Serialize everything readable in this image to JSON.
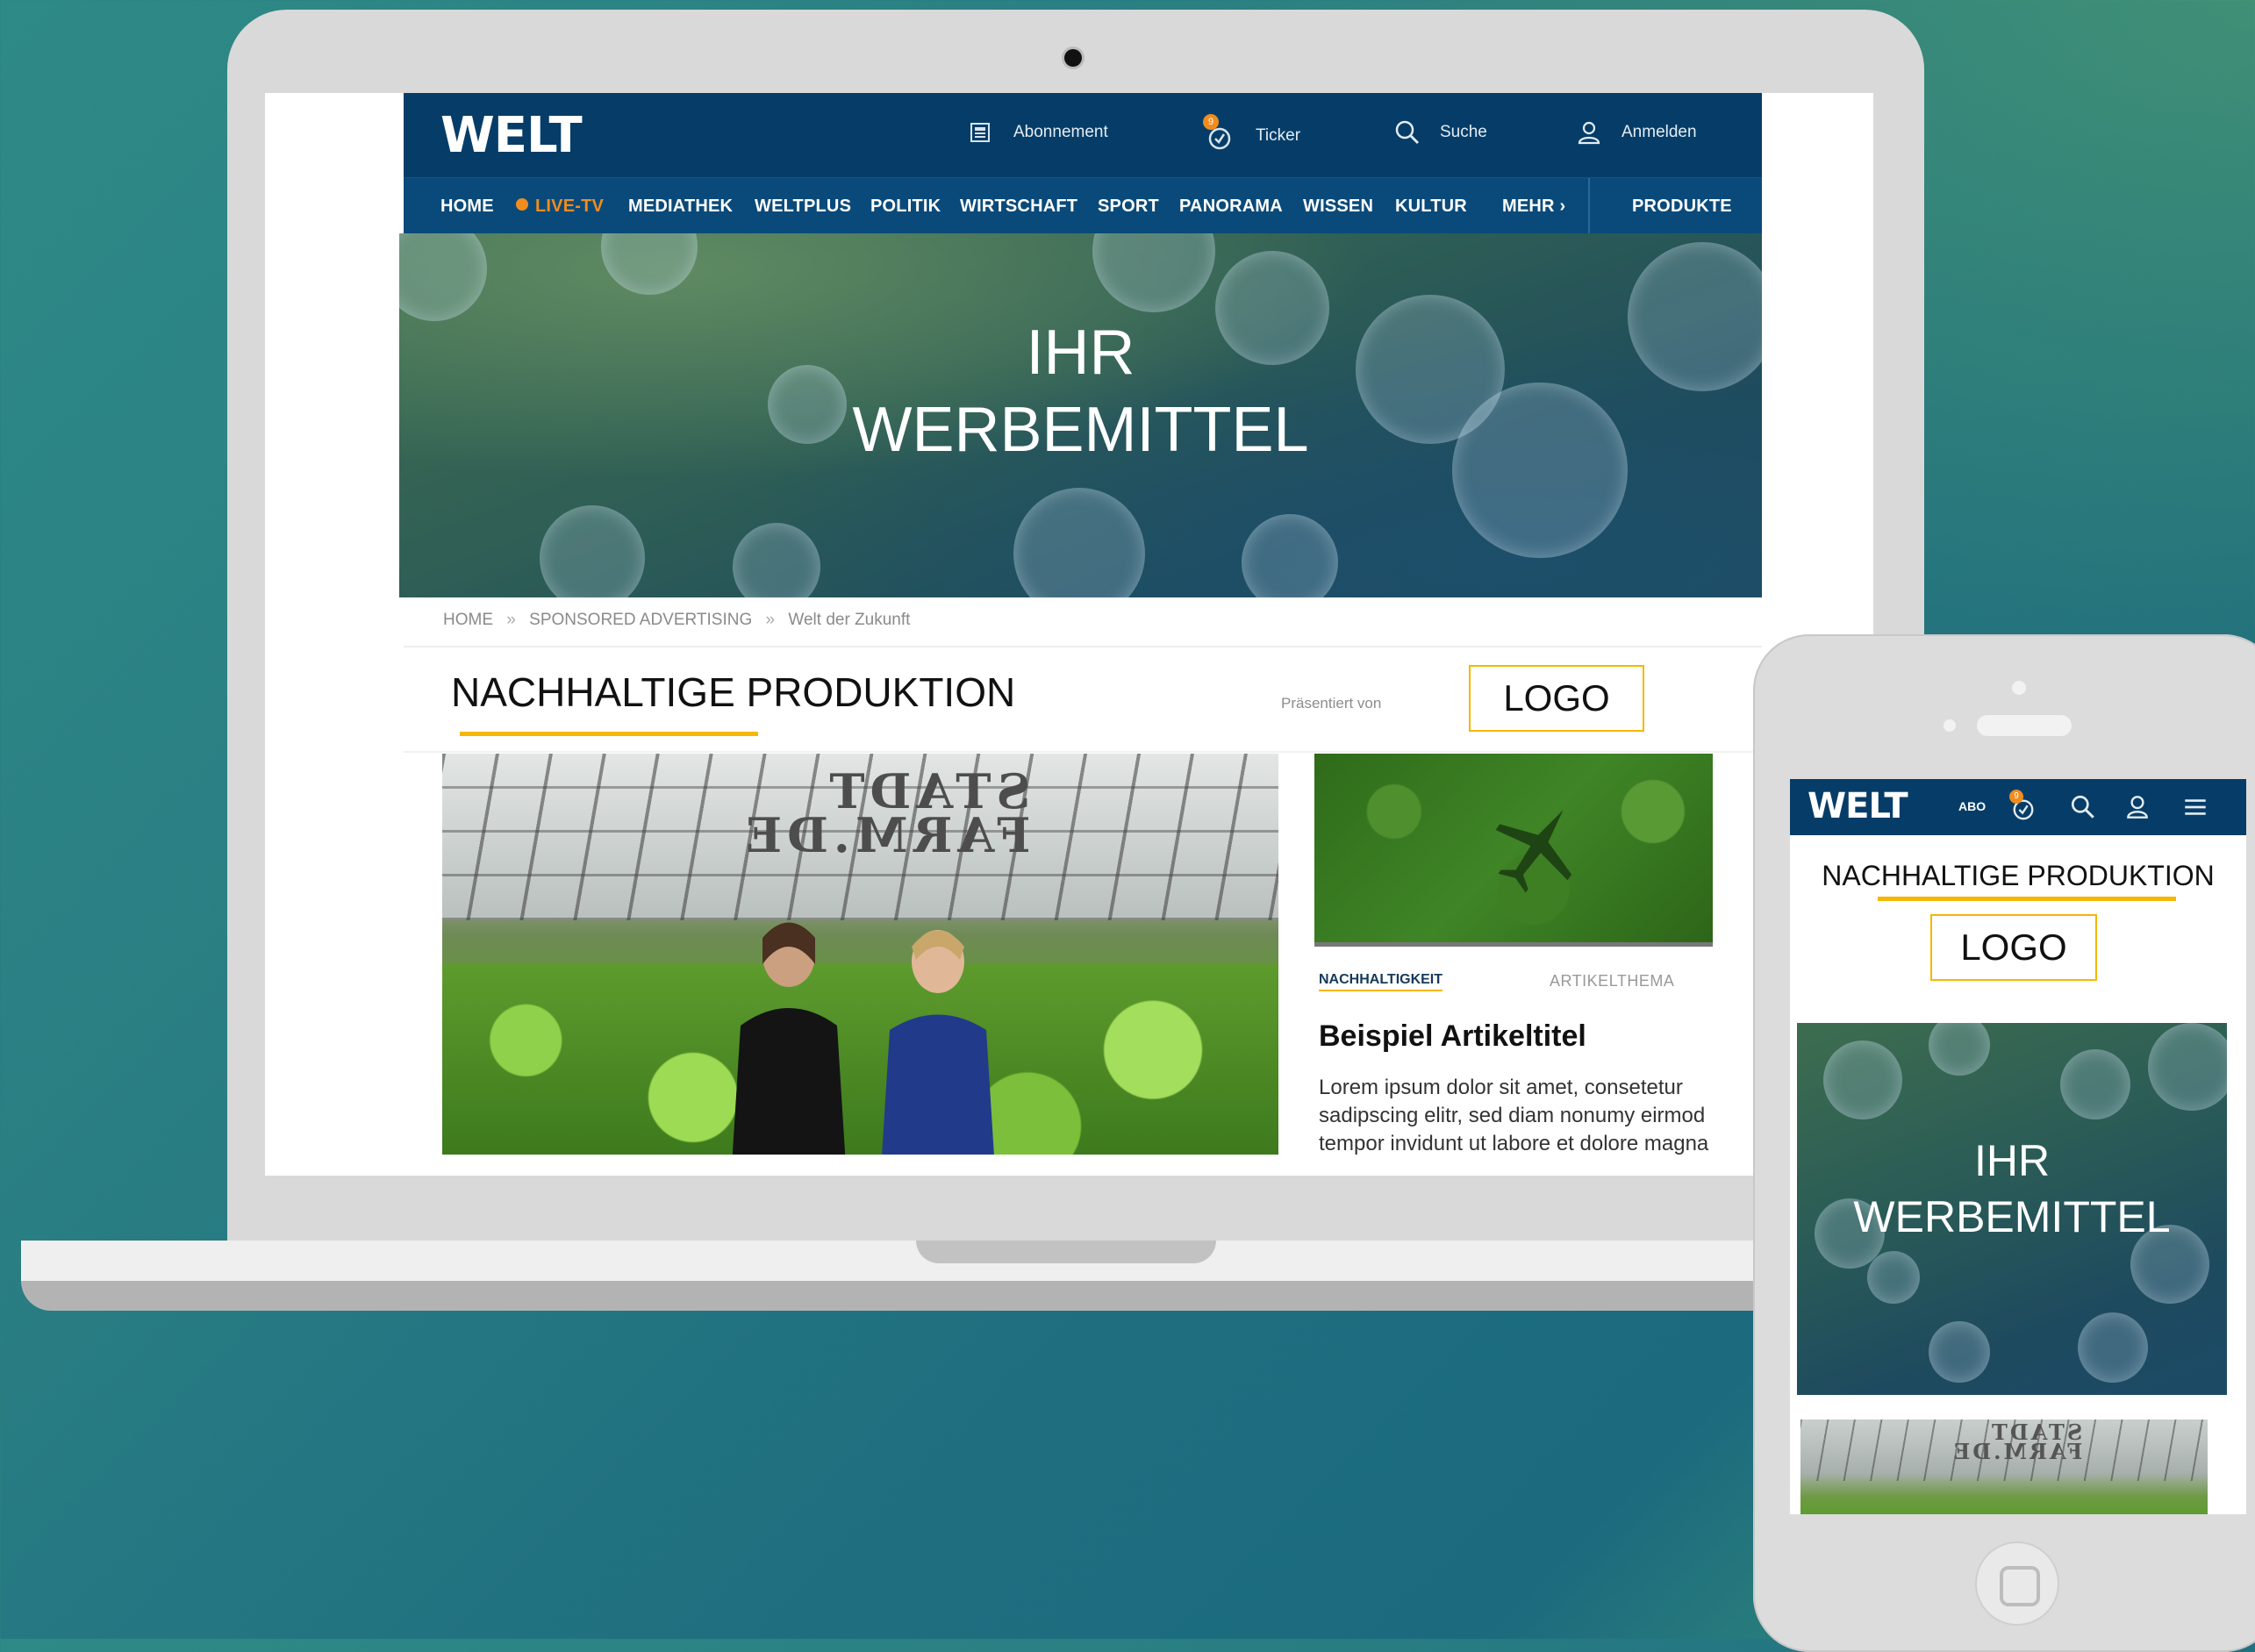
{
  "colors": {
    "brand_navy": "#063d68",
    "nav_blue": "#0a4a7a",
    "accent_orange": "#f08c1e",
    "accent_yellow": "#f5b700"
  },
  "desktop": {
    "brand": "WELT",
    "topbar": [
      {
        "label": "Abonnement",
        "icon": "newspaper-icon"
      },
      {
        "label": "Ticker",
        "icon": "ticker-clock-icon",
        "badge": "9"
      },
      {
        "label": "Suche",
        "icon": "search-icon"
      },
      {
        "label": "Anmelden",
        "icon": "user-icon"
      }
    ],
    "nav": [
      "HOME",
      "LIVE-TV",
      "MEDIATHEK",
      "WELTPLUS",
      "POLITIK",
      "WIRTSCHAFT",
      "SPORT",
      "PANORAMA",
      "WISSEN",
      "KULTUR",
      "MEHR",
      "PRODUKTE"
    ],
    "hero": {
      "line1": "IHR",
      "line2": "WERBEMITTEL"
    },
    "breadcrumb": [
      "HOME",
      "SPONSORED ADVERTISING",
      "Welt der Zukunft"
    ],
    "breadcrumb_separator": "»",
    "section_title": "NACHHALTIGE PRODUKTION",
    "presented_by": "Präsentiert von",
    "logo_placeholder": "LOGO",
    "main_image_sign": {
      "line1": "STADT",
      "line2": "FARM.DE"
    },
    "article": {
      "category": "NACHHALTIGKEIT",
      "topic": "ARTIKELTHEMA",
      "title": "Beispiel Artikeltitel",
      "body": "Lorem ipsum dolor sit amet, consetetur sadipscing elitr, sed diam nonumy eirmod tempor invidunt ut labore et dolore magna"
    }
  },
  "mobile": {
    "brand": "WELT",
    "abo": "ABO",
    "ticker_badge": "9",
    "section_title": "NACHHALTIGE PRODUKTION",
    "logo_placeholder": "LOGO",
    "hero": {
      "line1": "IHR",
      "line2": "WERBEMITTEL"
    },
    "image_sign": {
      "line1": "STADT",
      "line2": "FARM.DE"
    }
  }
}
